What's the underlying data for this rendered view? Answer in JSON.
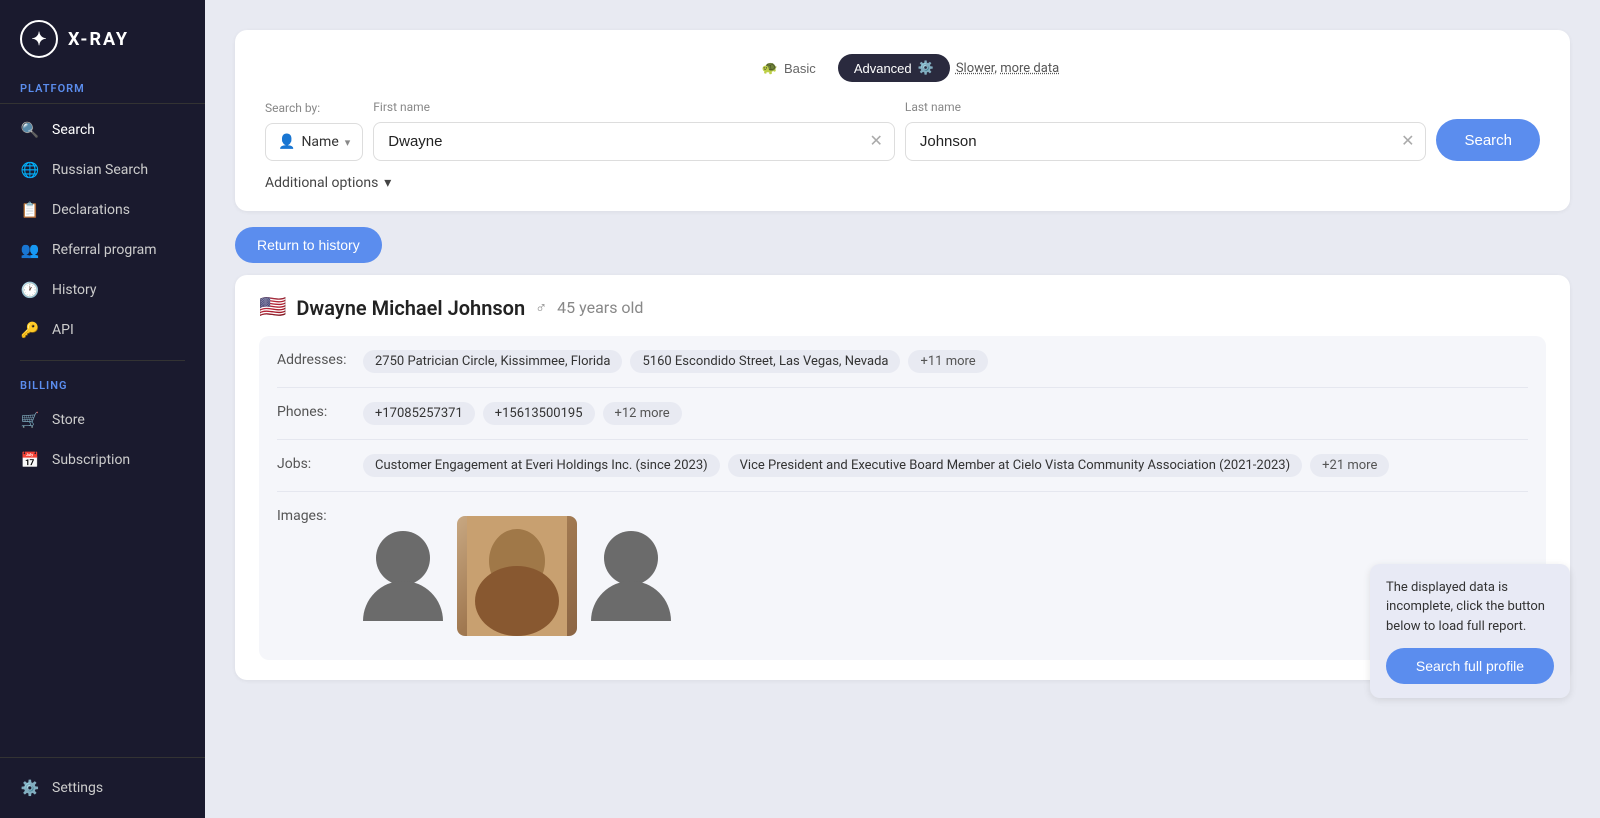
{
  "logo": {
    "icon": "✦",
    "text": "X-RAY"
  },
  "sidebar": {
    "platform_label": "Platform",
    "items": [
      {
        "id": "search",
        "label": "Search",
        "icon": "🔍"
      },
      {
        "id": "russian-search",
        "label": "Russian Search",
        "icon": "🌐"
      },
      {
        "id": "declarations",
        "label": "Declarations",
        "icon": "📋"
      },
      {
        "id": "referral",
        "label": "Referral program",
        "icon": "👥"
      },
      {
        "id": "history",
        "label": "History",
        "icon": "🕐"
      },
      {
        "id": "api",
        "label": "API",
        "icon": "🔑"
      }
    ],
    "billing_label": "Billing",
    "billing_items": [
      {
        "id": "store",
        "label": "Store",
        "icon": "🛒"
      },
      {
        "id": "subscription",
        "label": "Subscription",
        "icon": "📅"
      }
    ],
    "bottom_items": [
      {
        "id": "settings",
        "label": "Settings",
        "icon": "⚙️"
      }
    ]
  },
  "search": {
    "mode_basic": "Basic",
    "mode_advanced": "Advanced",
    "mode_description": "Slower,",
    "mode_highlight": "more data",
    "search_by_label": "Search by:",
    "search_by_value": "Name",
    "first_name_label": "First name",
    "first_name_value": "Dwayne",
    "last_name_label": "Last name",
    "last_name_value": "Johnson",
    "search_button": "Search",
    "additional_options": "Additional options"
  },
  "results": {
    "return_button": "Return to history",
    "profile": {
      "flag": "🇺🇸",
      "name": "Dwayne Michael Johnson",
      "gender_icon": "♂",
      "age": "45 years old",
      "addresses_label": "Addresses:",
      "addresses": [
        "2750 Patrician Circle, Kissimmee, Florida",
        "5160 Escondido Street, Las Vegas, Nevada",
        "+11 more"
      ],
      "phones_label": "Phones:",
      "phones": [
        "+17085257371",
        "+15613500195",
        "+12 more"
      ],
      "jobs_label": "Jobs:",
      "jobs": [
        "Customer Engagement at Everi Holdings Inc. (since 2023)",
        "Vice President and Executive Board Member at Cielo Vista Community Association (2021-2023)",
        "+21 more"
      ],
      "images_label": "Images:"
    }
  },
  "tooltip": {
    "text": "The displayed data is incomplete, click the button below to load full report.",
    "button": "Search full profile"
  }
}
